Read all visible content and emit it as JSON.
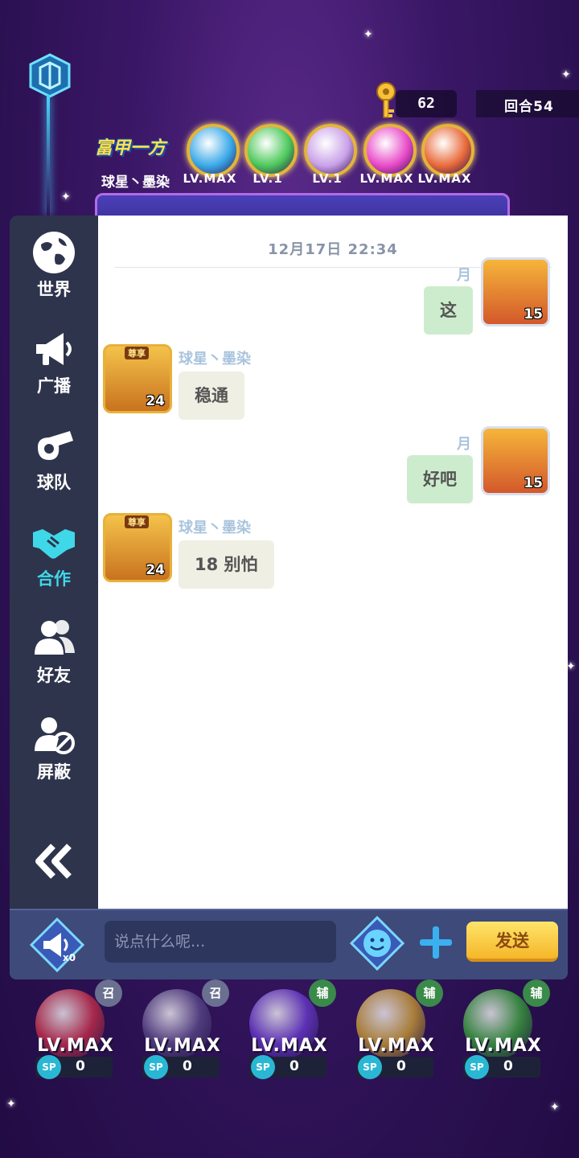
{
  "hud": {
    "keys": "62",
    "round": "回合54",
    "title_logo": "富甲一方",
    "player_name": "球星丶墨染",
    "buffs": [
      {
        "level": "LV.MAX",
        "color": "#3aa8e8",
        "icon": "swords-icon"
      },
      {
        "level": "LV.1",
        "color": "#4cc85a",
        "icon": "arrow-up-icon"
      },
      {
        "level": "LV.1",
        "color": "#c9a0e8",
        "icon": "team-icon"
      },
      {
        "level": "LV.MAX",
        "color": "#e84ac8",
        "icon": "shield-icon"
      },
      {
        "level": "LV.MAX",
        "color": "#e86a3a",
        "icon": "flame-icon"
      }
    ]
  },
  "sidebar": {
    "items": [
      {
        "label": "世界",
        "icon": "globe-icon",
        "active": false
      },
      {
        "label": "广播",
        "icon": "megaphone-icon",
        "active": false
      },
      {
        "label": "球队",
        "icon": "whistle-icon",
        "active": false
      },
      {
        "label": "合作",
        "icon": "handshake-icon",
        "active": true
      },
      {
        "label": "好友",
        "icon": "friends-icon",
        "active": false
      },
      {
        "label": "屏蔽",
        "icon": "block-user-icon",
        "active": false
      }
    ],
    "collapse_icon": "double-chevron-left-icon"
  },
  "chat": {
    "timestamp": "12月17日 22:34",
    "messages": [
      {
        "side": "right",
        "name": "月",
        "text": "这",
        "level": "15"
      },
      {
        "side": "left",
        "name": "球星丶墨染",
        "text": "稳通",
        "level": "24",
        "vip": "尊享"
      },
      {
        "side": "right",
        "name": "月",
        "text": "好吧",
        "level": "15"
      },
      {
        "side": "left",
        "name": "球星丶墨染",
        "text": "18 别怕",
        "level": "24",
        "vip": "尊享"
      }
    ]
  },
  "input": {
    "placeholder": "说点什么呢...",
    "horn_count": "x0",
    "send_label": "发送"
  },
  "skills": [
    {
      "level": "LV.MAX",
      "tag": "召",
      "sp": "0",
      "color": "#d0304a",
      "tag_color": "#6a7090"
    },
    {
      "level": "LV.MAX",
      "tag": "召",
      "sp": "0",
      "color": "#5a4a8a",
      "tag_color": "#6a7090"
    },
    {
      "level": "LV.MAX",
      "tag": "辅",
      "sp": "0",
      "color": "#6a3ad0",
      "tag_color": "#3a8a4a"
    },
    {
      "level": "LV.MAX",
      "tag": "辅",
      "sp": "0",
      "color": "#d0a030",
      "tag_color": "#3a8a4a"
    },
    {
      "level": "LV.MAX",
      "tag": "辅",
      "sp": "0",
      "color": "#3aa83a",
      "tag_color": "#3a8a4a"
    }
  ]
}
